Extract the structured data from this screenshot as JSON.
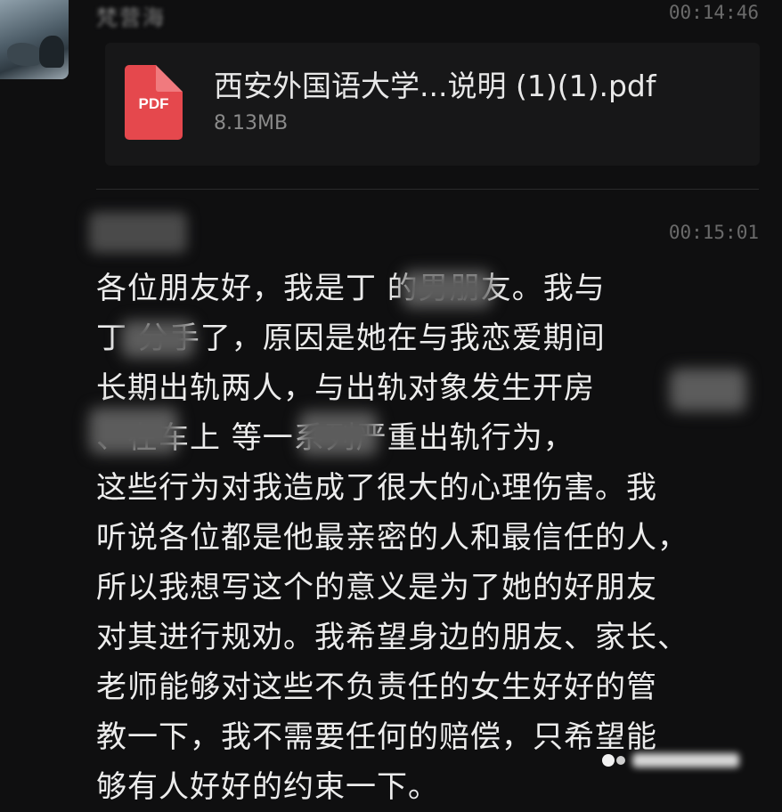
{
  "chat": {
    "sender_name": "梵营海",
    "time1": "00:14:46",
    "time2": "00:15:01"
  },
  "file": {
    "icon_label": "PDF",
    "name": "西安外国语大学...说明 (1)(1).pdf",
    "size": "8.13MB",
    "icon_color": "#e5484d"
  },
  "message": {
    "lines": [
      "各位朋友好，我是丁     的男朋友。我与",
      "丁     分手了，原因是她在与我恋爱期间",
      "长期出轨两人，与出轨对象发生开房",
      "     、在车上     等一系列严重出轨行为，",
      "这些行为对我造成了很大的心理伤害。我",
      "听说各位都是他最亲密的人和最信任的人，",
      "所以我想写这个的意义是为了她的好朋友",
      "对其进行规劝。我希望身边的朋友、家长、",
      "老师能够对这些不负责任的女生好好的管",
      "教一下，我不需要任何的赔偿，只希望能",
      "够有人好好的约束一下。"
    ]
  },
  "colors": {
    "background": "#0f0f10",
    "card": "#171718",
    "text": "#ececec",
    "muted": "#6a6a6a"
  }
}
